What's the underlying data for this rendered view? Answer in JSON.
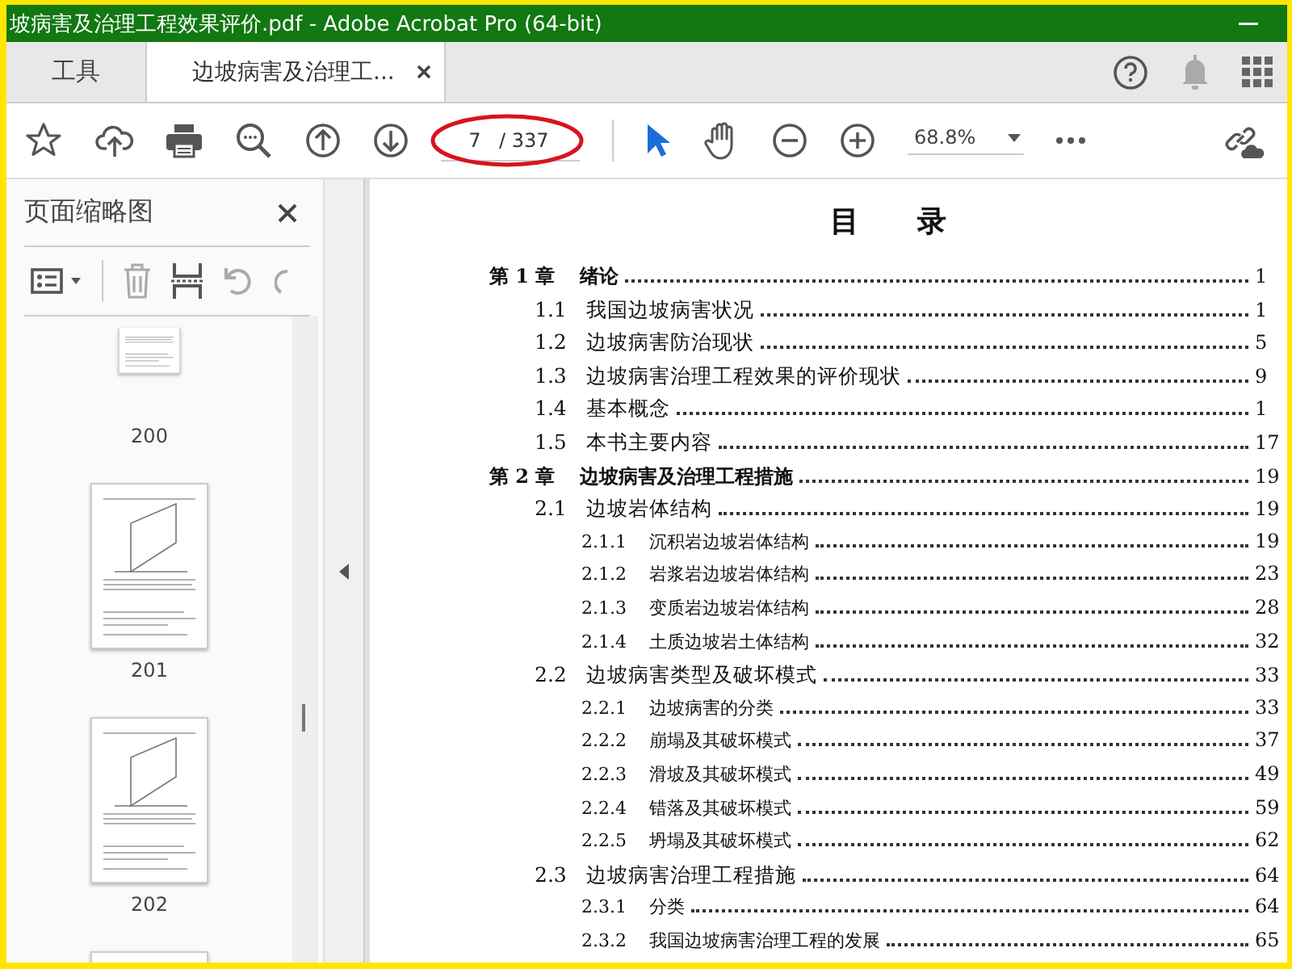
{
  "window": {
    "title": "坡病害及治理工程效果评价.pdf - Adobe Acrobat Pro (64-bit)"
  },
  "tabs": [
    {
      "label": "工具",
      "selected": false
    },
    {
      "label": "边坡病害及治理工...",
      "selected": true
    }
  ],
  "toolbar": {
    "page_number": "7",
    "page_total": "/ 337",
    "zoom": "68.8%"
  },
  "sidebar": {
    "title": "页面缩略图",
    "thumbnails": [
      {
        "label": "200"
      },
      {
        "label": "201"
      },
      {
        "label": "202"
      }
    ]
  },
  "document": {
    "heading": "目　　录",
    "toc": [
      {
        "number": "第 1 章",
        "title": "绪论",
        "page": "1",
        "children": [
          {
            "number": "1.1",
            "title": "我国边坡病害状况",
            "page": "1"
          },
          {
            "number": "1.2",
            "title": "边坡病害防治现状",
            "page": "5"
          },
          {
            "number": "1.3",
            "title": "边坡病害治理工程效果的评价现状",
            "page": "9"
          },
          {
            "number": "1.4",
            "title": "基本概念",
            "page": "1"
          },
          {
            "number": "1.5",
            "title": "本书主要内容",
            "page": "17"
          }
        ]
      },
      {
        "number": "第 2 章",
        "title": "边坡病害及治理工程措施",
        "page": "19",
        "children": [
          {
            "number": "2.1",
            "title": "边坡岩体结构",
            "page": "19",
            "children": [
              {
                "number": "2.1.1",
                "title": "沉积岩边坡岩体结构",
                "page": "19"
              },
              {
                "number": "2.1.2",
                "title": "岩浆岩边坡岩体结构",
                "page": "23"
              },
              {
                "number": "2.1.3",
                "title": "变质岩边坡岩体结构",
                "page": "28"
              },
              {
                "number": "2.1.4",
                "title": "土质边坡岩土体结构",
                "page": "32"
              }
            ]
          },
          {
            "number": "2.2",
            "title": "边坡病害类型及破坏模式",
            "page": "33",
            "children": [
              {
                "number": "2.2.1",
                "title": "边坡病害的分类",
                "page": "33"
              },
              {
                "number": "2.2.2",
                "title": "崩塌及其破坏模式",
                "page": "37"
              },
              {
                "number": "2.2.3",
                "title": "滑坡及其破坏模式",
                "page": "49"
              },
              {
                "number": "2.2.4",
                "title": "错落及其破坏模式",
                "page": "59"
              },
              {
                "number": "2.2.5",
                "title": "坍塌及其破坏模式",
                "page": "62"
              }
            ]
          },
          {
            "number": "2.3",
            "title": "边坡病害治理工程措施",
            "page": "64",
            "children": [
              {
                "number": "2.3.1",
                "title": "分类",
                "page": "64"
              },
              {
                "number": "2.3.2",
                "title": "我国边坡病害治理工程的发展",
                "page": "65"
              }
            ]
          }
        ]
      }
    ]
  }
}
